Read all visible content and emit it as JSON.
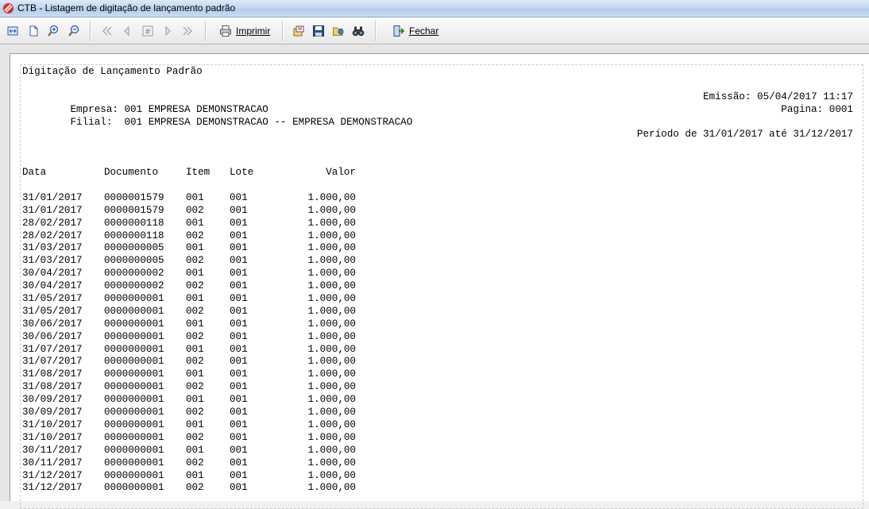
{
  "window": {
    "title": "CTB - Listagem de digitação de lançamento padrão"
  },
  "toolbar": {
    "print_label": "Imprimir",
    "close_label": "Fechar"
  },
  "report": {
    "title": "Digitação de Lançamento Padrão",
    "empresa": "Empresa: 001 EMPRESA DEMONSTRACAO",
    "emissao": "Emissão: 05/04/2017 11:17",
    "filial": "Filial:  001 EMPRESA DEMONSTRACAO -- EMPRESA DEMONSTRACAO",
    "pagina": "Pagina: 0001",
    "periodo": "Período de 31/01/2017 até 31/12/2017",
    "columns": {
      "data": "Data",
      "documento": "Documento",
      "item": "Item",
      "lote": "Lote",
      "valor": "Valor"
    },
    "rows": [
      {
        "data": "31/01/2017",
        "documento": "0000001579",
        "item": "001",
        "lote": "001",
        "valor": "1.000,00"
      },
      {
        "data": "31/01/2017",
        "documento": "0000001579",
        "item": "002",
        "lote": "001",
        "valor": "1.000,00"
      },
      {
        "data": "28/02/2017",
        "documento": "0000000118",
        "item": "001",
        "lote": "001",
        "valor": "1.000,00"
      },
      {
        "data": "28/02/2017",
        "documento": "0000000118",
        "item": "002",
        "lote": "001",
        "valor": "1.000,00"
      },
      {
        "data": "31/03/2017",
        "documento": "0000000005",
        "item": "001",
        "lote": "001",
        "valor": "1.000,00"
      },
      {
        "data": "31/03/2017",
        "documento": "0000000005",
        "item": "002",
        "lote": "001",
        "valor": "1.000,00"
      },
      {
        "data": "30/04/2017",
        "documento": "0000000002",
        "item": "001",
        "lote": "001",
        "valor": "1.000,00"
      },
      {
        "data": "30/04/2017",
        "documento": "0000000002",
        "item": "002",
        "lote": "001",
        "valor": "1.000,00"
      },
      {
        "data": "31/05/2017",
        "documento": "0000000001",
        "item": "001",
        "lote": "001",
        "valor": "1.000,00"
      },
      {
        "data": "31/05/2017",
        "documento": "0000000001",
        "item": "002",
        "lote": "001",
        "valor": "1.000,00"
      },
      {
        "data": "30/06/2017",
        "documento": "0000000001",
        "item": "001",
        "lote": "001",
        "valor": "1.000,00"
      },
      {
        "data": "30/06/2017",
        "documento": "0000000001",
        "item": "002",
        "lote": "001",
        "valor": "1.000,00"
      },
      {
        "data": "31/07/2017",
        "documento": "0000000001",
        "item": "001",
        "lote": "001",
        "valor": "1.000,00"
      },
      {
        "data": "31/07/2017",
        "documento": "0000000001",
        "item": "002",
        "lote": "001",
        "valor": "1.000,00"
      },
      {
        "data": "31/08/2017",
        "documento": "0000000001",
        "item": "001",
        "lote": "001",
        "valor": "1.000,00"
      },
      {
        "data": "31/08/2017",
        "documento": "0000000001",
        "item": "002",
        "lote": "001",
        "valor": "1.000,00"
      },
      {
        "data": "30/09/2017",
        "documento": "0000000001",
        "item": "001",
        "lote": "001",
        "valor": "1.000,00"
      },
      {
        "data": "30/09/2017",
        "documento": "0000000001",
        "item": "002",
        "lote": "001",
        "valor": "1.000,00"
      },
      {
        "data": "31/10/2017",
        "documento": "0000000001",
        "item": "001",
        "lote": "001",
        "valor": "1.000,00"
      },
      {
        "data": "31/10/2017",
        "documento": "0000000001",
        "item": "002",
        "lote": "001",
        "valor": "1.000,00"
      },
      {
        "data": "30/11/2017",
        "documento": "0000000001",
        "item": "001",
        "lote": "001",
        "valor": "1.000,00"
      },
      {
        "data": "30/11/2017",
        "documento": "0000000001",
        "item": "002",
        "lote": "001",
        "valor": "1.000,00"
      },
      {
        "data": "31/12/2017",
        "documento": "0000000001",
        "item": "001",
        "lote": "001",
        "valor": "1.000,00"
      },
      {
        "data": "31/12/2017",
        "documento": "0000000001",
        "item": "002",
        "lote": "001",
        "valor": "1.000,00"
      }
    ]
  },
  "icons": {
    "app": "app-logo-icon",
    "fit": "fit-page-icon",
    "page": "single-page-icon",
    "zoom_in": "zoom-in-icon",
    "zoom_out": "zoom-out-icon",
    "first": "first-page-icon",
    "prev": "previous-page-icon",
    "goto": "go-to-page-icon",
    "next": "next-page-icon",
    "last": "last-page-icon",
    "printer": "printer-icon",
    "export": "export-icon",
    "save": "save-icon",
    "open": "open-folder-icon",
    "find": "find-binoculars-icon",
    "exit": "exit-door-icon"
  },
  "colors": {
    "accent": "#1f4fa3",
    "logo": "#d8332a"
  }
}
